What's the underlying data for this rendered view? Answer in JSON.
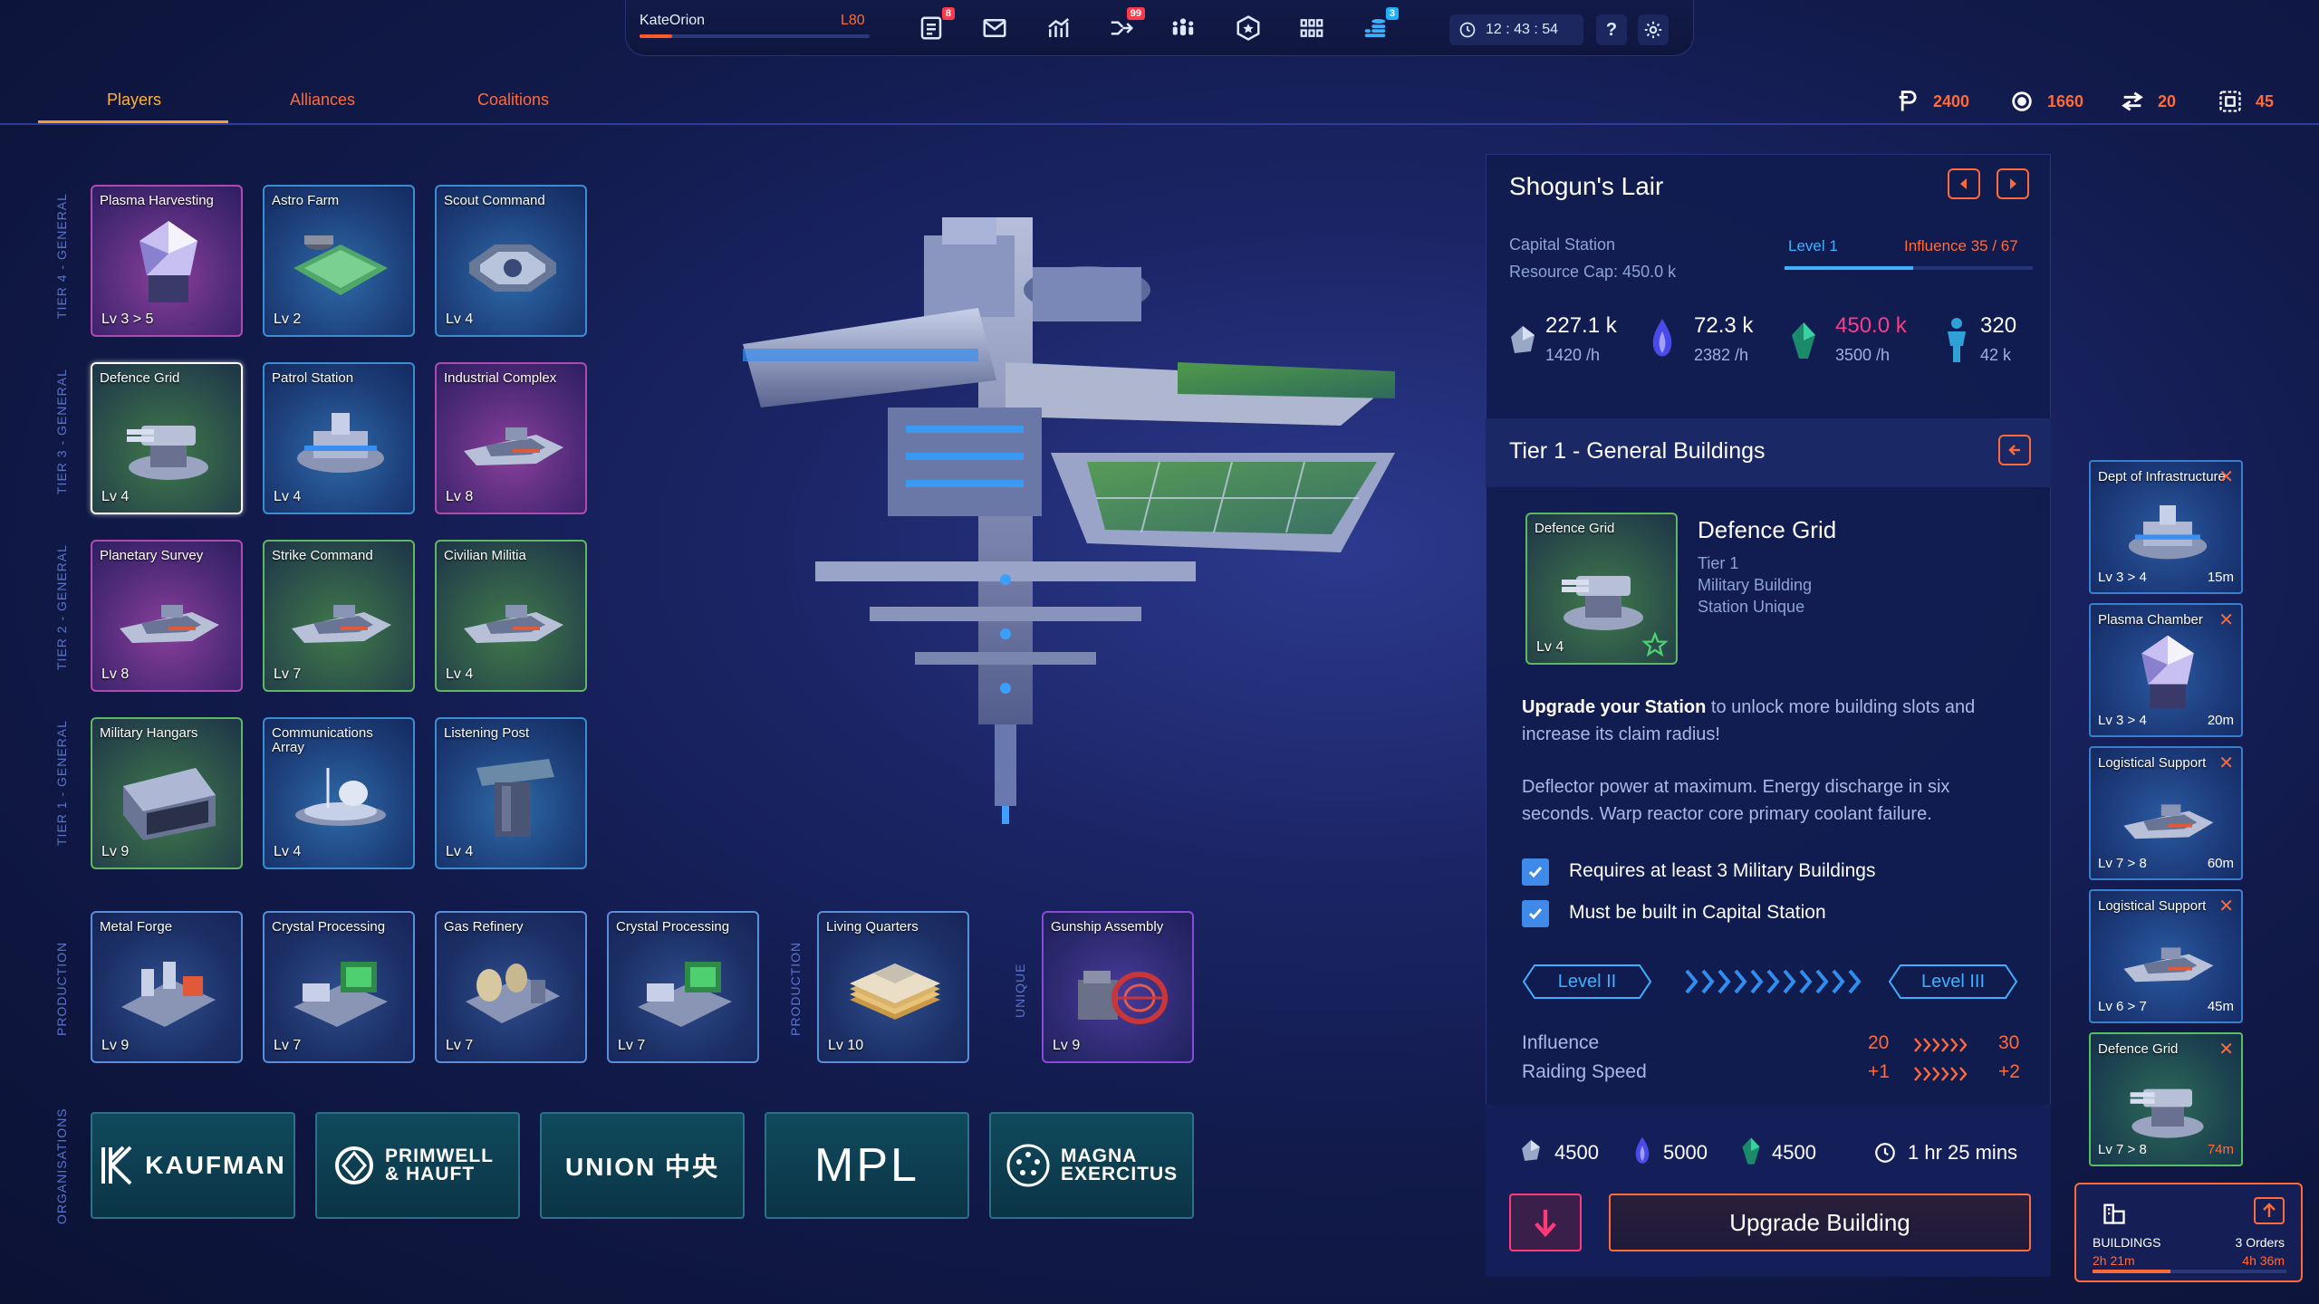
{
  "topbar": {
    "player_name": "KateOrion",
    "player_level": "L80",
    "xp_progress": 0.14,
    "icons": [
      {
        "name": "reports-icon",
        "badge": "8",
        "badge_color": "red"
      },
      {
        "name": "mail-icon",
        "badge": "",
        "badge_color": ""
      },
      {
        "name": "stats-icon",
        "badge": "",
        "badge_color": ""
      },
      {
        "name": "fleet-icon",
        "badge": "99",
        "badge_color": "red"
      },
      {
        "name": "people-icon",
        "badge": "",
        "badge_color": ""
      },
      {
        "name": "badge-icon",
        "badge": "",
        "badge_color": ""
      },
      {
        "name": "grid-icon",
        "badge": "",
        "badge_color": ""
      },
      {
        "name": "coins-icon",
        "badge": "3",
        "badge_color": "blue"
      }
    ],
    "clock": "12 : 43 : 54",
    "help_label": "?"
  },
  "tabs": [
    {
      "label": "Players",
      "active": true
    },
    {
      "label": "Alliances",
      "active": false
    },
    {
      "label": "Coalitions",
      "active": false
    }
  ],
  "resources": [
    {
      "icon": "credits-icon",
      "value": "2400"
    },
    {
      "icon": "cycle-icon",
      "value": "1660"
    },
    {
      "icon": "transfer-icon",
      "value": "20"
    },
    {
      "icon": "slots-icon",
      "value": "45"
    }
  ],
  "tiers": [
    {
      "label": "TIER 4 - GENERAL",
      "buildings": [
        {
          "title": "Plasma Harvesting",
          "level": "Lv 3 > 5",
          "style": "purple",
          "art": "crystal"
        },
        {
          "title": "Astro Farm",
          "level": "Lv 2",
          "style": "blue",
          "art": "farm"
        },
        {
          "title": "Scout Command",
          "level": "Lv 4",
          "style": "blue",
          "art": "octagon"
        }
      ]
    },
    {
      "label": "TIER 3 - GENERAL",
      "buildings": [
        {
          "title": "Defence Grid",
          "level": "Lv 4",
          "style": "green selected",
          "art": "turret"
        },
        {
          "title": "Patrol Station",
          "level": "Lv 4",
          "style": "blue",
          "art": "station"
        },
        {
          "title": "Industrial Complex",
          "level": "Lv 8",
          "style": "purple",
          "art": "ship"
        }
      ]
    },
    {
      "label": "TIER 2 - GENERAL",
      "buildings": [
        {
          "title": "Planetary Survey",
          "level": "Lv 8",
          "style": "purple",
          "art": "ship"
        },
        {
          "title": "Strike Command",
          "level": "Lv 7",
          "style": "green",
          "art": "ship"
        },
        {
          "title": "Civilian Militia",
          "level": "Lv 4",
          "style": "green",
          "art": "ship"
        }
      ]
    },
    {
      "label": "TIER 1 - GENERAL",
      "buildings": [
        {
          "title": "Military Hangars",
          "level": "Lv 9",
          "style": "green",
          "art": "hangar"
        },
        {
          "title": "Communications Array",
          "level": "Lv 4",
          "style": "blue",
          "art": "dish"
        },
        {
          "title": "Listening Post",
          "level": "Lv 4",
          "style": "blue",
          "art": "tower"
        }
      ]
    }
  ],
  "production_label": "PRODUCTION",
  "production": [
    {
      "title": "Metal Forge",
      "level": "Lv 9"
    },
    {
      "title": "Crystal Processing",
      "level": "Lv 7"
    },
    {
      "title": "Gas Refinery",
      "level": "Lv 7"
    },
    {
      "title": "Crystal Processing",
      "level": "Lv 7"
    }
  ],
  "production2_label": "PRODUCTION",
  "production2": {
    "title": "Living Quarters",
    "level": "Lv 10"
  },
  "unique_label": "UNIQUE",
  "unique": {
    "title": "Gunship Assembly",
    "level": "Lv 9"
  },
  "organisations_label": "ORGANISATIONS",
  "organisations": [
    {
      "name": "KAUFMAN",
      "icon": "k-logo-icon"
    },
    {
      "name": "PRIMWELL & HAUFT",
      "icon": "ring-logo-icon"
    },
    {
      "name": "UNION 中央",
      "icon": ""
    },
    {
      "name": "MPL",
      "icon": ""
    },
    {
      "name": "MAGNA EXERCITUS",
      "icon": "star-ring-logo-icon"
    }
  ],
  "station": {
    "name": "Shogun's Lair",
    "type": "Capital Station",
    "resource_cap": "Resource Cap: 450.0 k",
    "level": "Level 1",
    "influence": "Influence 35 / 67",
    "influence_fraction": 0.52,
    "stats": [
      {
        "icon": "ore-icon",
        "value": "227.1 k",
        "rate": "1420 /h",
        "color": "#ffffff"
      },
      {
        "icon": "plasma-icon",
        "value": "72.3 k",
        "rate": "2382 /h",
        "color": "#ffffff"
      },
      {
        "icon": "crystal-icon",
        "value": "450.0 k",
        "rate": "3500 /h",
        "color": "#ff3a8a"
      },
      {
        "icon": "population-icon",
        "value": "320",
        "rate": "42 k",
        "color": "#ffffff"
      }
    ]
  },
  "tier_section": {
    "title": "Tier 1 - General Buildings",
    "building": {
      "card_title": "Defence Grid",
      "card_level": "Lv 4",
      "name": "Defence Grid",
      "tier": "Tier 1",
      "category": "Military Building",
      "scope": "Station Unique"
    },
    "desc_bold": "Upgrade your Station",
    "desc_rest": " to unlock more building slots and increase its claim radius!",
    "desc2": "Deflector power at maximum. Energy discharge in six seconds. Warp reactor core primary coolant failure.",
    "requirements": [
      "Requires at least 3 Military Buildings",
      "Must be built in Capital Station"
    ],
    "level_from": "Level  II",
    "level_to": "Level  III",
    "upgrade_stats": [
      {
        "label": "Influence",
        "from": "20",
        "to": "30"
      },
      {
        "label": "Raiding Speed",
        "from": "+1",
        "to": "+2"
      }
    ],
    "costs": [
      {
        "icon": "ore-icon",
        "value": "4500"
      },
      {
        "icon": "plasma-icon",
        "value": "5000"
      },
      {
        "icon": "crystal-icon",
        "value": "4500"
      }
    ],
    "time": "1 hr 25 mins",
    "upgrade_label": "Upgrade Building"
  },
  "queue": [
    {
      "title": "Dept of Infrastructure",
      "level": "Lv 3 > 4",
      "time": "15m",
      "style": "",
      "art": "station"
    },
    {
      "title": "Plasma Chamber",
      "level": "Lv 3 > 4",
      "time": "20m",
      "style": "",
      "art": "crystal"
    },
    {
      "title": "Logistical Support",
      "level": "Lv 7 > 8",
      "time": "60m",
      "style": "",
      "art": "ship"
    },
    {
      "title": "Logistical Support",
      "level": "Lv 6 > 7",
      "time": "45m",
      "style": "",
      "art": "ship"
    },
    {
      "title": "Defence Grid",
      "level": "Lv 7 > 8",
      "time": "74m",
      "style": "green",
      "art": "turret"
    }
  ],
  "buildings_box": {
    "label": "BUILDINGS",
    "time": "2h 21m",
    "orders": "3 Orders",
    "orders_time": "4h 36m",
    "progress": 0.4
  }
}
